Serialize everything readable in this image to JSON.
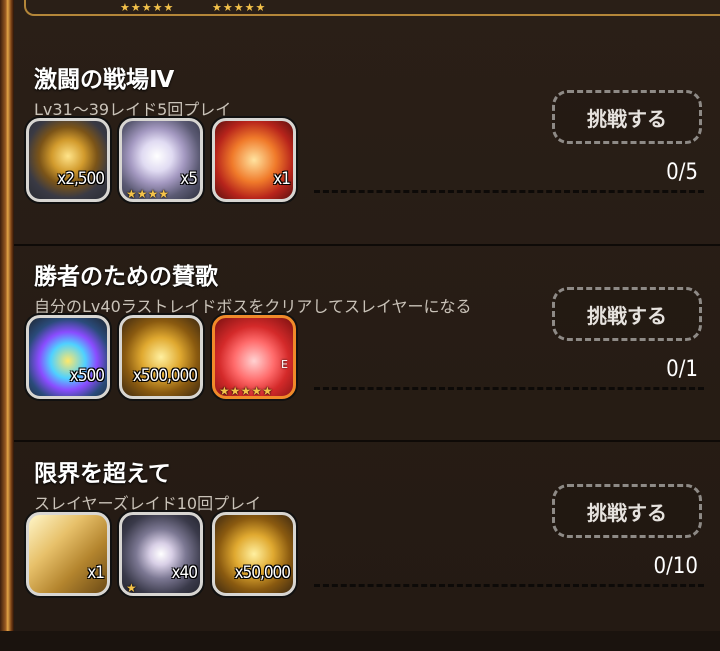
{
  "top_stars": [
    "★★★★★",
    "★★★★★"
  ],
  "missions": [
    {
      "title": "激闘の戦場Ⅳ",
      "description": "Lv31〜39レイド5回プレイ",
      "items": [
        {
          "icon": "medal-icon",
          "qty": "x2,500",
          "stars": ""
        },
        {
          "icon": "diamond-icon",
          "qty": "x5",
          "stars": "★★★★"
        },
        {
          "icon": "ticket-icon",
          "qty": "x1",
          "stars": ""
        }
      ],
      "button": "挑戦する",
      "progress": "0/5"
    },
    {
      "title": "勝者のための賛歌",
      "description": "自分のLv40ラストレイドボスをクリアしてスレイヤーになる",
      "items": [
        {
          "icon": "rainbow-gem-icon",
          "qty": "x500",
          "stars": ""
        },
        {
          "icon": "gold-coins-icon",
          "qty": "x500,000",
          "stars": ""
        },
        {
          "icon": "fire-crest-icon",
          "qty": "",
          "stars": "★★★★★",
          "corner": "E"
        }
      ],
      "button": "挑戦する",
      "progress": "0/1"
    },
    {
      "title": "限界を超えて",
      "description": "スレイヤーズレイド10回プレイ",
      "items": [
        {
          "icon": "gold-card-icon",
          "qty": "x1",
          "stars": ""
        },
        {
          "icon": "crystal-orb-icon",
          "qty": "x40",
          "stars": "★"
        },
        {
          "icon": "gold-coins-icon",
          "qty": "x50,000",
          "stars": ""
        }
      ],
      "button": "挑戦する",
      "progress": "0/10"
    }
  ]
}
